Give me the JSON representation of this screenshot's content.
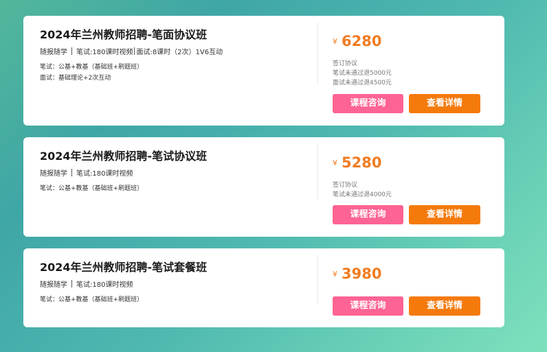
{
  "courses": [
    {
      "title": "2024年兰州教师招聘-笔面协议班",
      "meta": {
        "a": "随报随学",
        "b": "笔试:180课时视频",
        "c": "面试:8课时（2次）1V6互动"
      },
      "details": [
        "笔试：公基+教基（基础班+刷题班）",
        "面试：基础理论+2次互动"
      ],
      "currency": "¥",
      "price": "6280",
      "notes": [
        "签订协议",
        "笔试未通过退5000元",
        "面试未通过退4500元"
      ],
      "consult_label": "课程咨询",
      "detail_label": "查看详情"
    },
    {
      "title": "2024年兰州教师招聘-笔试协议班",
      "meta": {
        "a": "随报随学",
        "b": "笔试:180课时视频"
      },
      "details": [
        "笔试：公基+教基（基础班+刷题班）"
      ],
      "currency": "¥",
      "price": "5280",
      "notes": [
        "签订协议",
        "笔试未通过退4000元"
      ],
      "consult_label": "课程咨询",
      "detail_label": "查看详情"
    },
    {
      "title": "2024年兰州教师招聘-笔试套餐班",
      "meta": {
        "a": "随报随学",
        "b": "笔试:180课时视频"
      },
      "details": [
        "笔试：公基+教基（基础班+刷题班）"
      ],
      "currency": "¥",
      "price": "3980",
      "notes": [],
      "consult_label": "课程咨询",
      "detail_label": "查看详情"
    }
  ],
  "colors": {
    "price": "#f07c22",
    "consult_button": "#fd6393",
    "detail_button": "#f57a0c"
  }
}
